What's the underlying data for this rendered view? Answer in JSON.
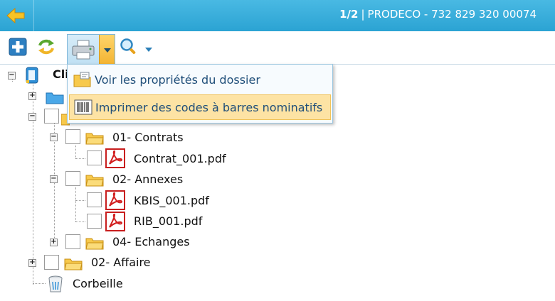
{
  "header": {
    "page_indicator": "1/2",
    "separator": "|",
    "record_title": "PRODECO - 732 829 320 00074"
  },
  "toolbar": {
    "buttons": [
      {
        "name": "add",
        "icon": "plus-icon"
      },
      {
        "name": "refresh",
        "icon": "refresh-icon"
      },
      {
        "name": "print",
        "icon": "printer-icon"
      },
      {
        "name": "search",
        "icon": "magnifier-icon"
      }
    ]
  },
  "menu": {
    "items": [
      {
        "label": "Voir les propriétés du dossier",
        "icon": "folder-properties-icon"
      },
      {
        "label": "Imprimer des codes à barres nominatifs",
        "icon": "barcode-icon",
        "highlighted": true
      }
    ]
  },
  "tree": {
    "root_label": "Cli",
    "nodes": [
      {
        "label": "01- Contrats",
        "type": "folder"
      },
      {
        "label": "Contrat_001.pdf",
        "type": "pdf"
      },
      {
        "label": "02- Annexes",
        "type": "folder"
      },
      {
        "label": "KBIS_001.pdf",
        "type": "pdf"
      },
      {
        "label": "RIB_001.pdf",
        "type": "pdf"
      },
      {
        "label": "04- Echanges",
        "type": "folder"
      },
      {
        "label": "02- Affaire",
        "type": "folder"
      },
      {
        "label": "Corbeille",
        "type": "trash"
      }
    ]
  },
  "colors": {
    "header_bg": "#2ba3d3",
    "menu_highlight": "#fde3a4",
    "menu_text": "#1f4e79"
  }
}
